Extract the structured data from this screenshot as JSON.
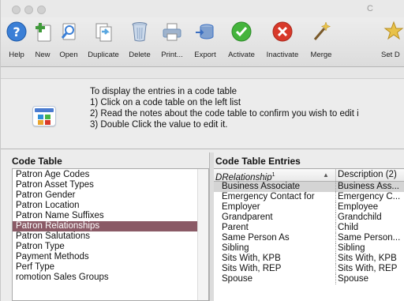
{
  "window": {
    "title": "C"
  },
  "toolbar": {
    "buttons": [
      {
        "label": "Help",
        "icon": "help-icon",
        "color": "#3b7fd6"
      },
      {
        "label": "New",
        "icon": "new-document-icon",
        "color": "#3f9a3a"
      },
      {
        "label": "Open",
        "icon": "open-document-icon",
        "color": "#3b7fd6"
      },
      {
        "label": "Duplicate",
        "icon": "duplicate-icon",
        "color": "#5aa7e0"
      },
      {
        "label": "Delete",
        "icon": "trash-icon",
        "color": "#8fa8c8"
      },
      {
        "label": "Print...",
        "icon": "print-icon",
        "color": "#6c8fb8"
      },
      {
        "label": "Export",
        "icon": "export-icon",
        "color": "#3b6fc1"
      },
      {
        "label": "Activate",
        "icon": "checkmark-icon",
        "color": "#44b43c"
      },
      {
        "label": "Inactivate",
        "icon": "x-icon",
        "color": "#d8392a"
      },
      {
        "label": "Merge",
        "icon": "magic-wand-icon",
        "color": "#d6b34a"
      },
      {
        "label": "Set D",
        "icon": "set-default-icon",
        "color": "#d6b34a"
      }
    ]
  },
  "instructions": {
    "icon": "code-table-icon",
    "lines": [
      "To display the entries in a code table",
      "1) Click on a code table on the left list",
      "2) Read the notes about the code table to confirm you wish to edit i",
      "3) Double Click the value to edit it."
    ]
  },
  "left_pane": {
    "header": "Code Table",
    "items": [
      "Patron Age Codes",
      "Patron Asset Types",
      "Patron Gender",
      "Patron Location",
      "Patron Name Suffixes",
      "Patron Relationships",
      "Patron Salutations",
      "Patron Type",
      "Payment Methods",
      "Perf Type",
      "romotion Sales Groups"
    ],
    "selected_index": 5
  },
  "right_pane": {
    "header": "Code Table Entries",
    "columns": [
      "Relationship",
      "Description (2)"
    ],
    "first_column_prefix": "D",
    "first_column_sort_rank": "1",
    "sort_arrow": "▲",
    "rows": [
      [
        "Business Associate",
        "Business Ass..."
      ],
      [
        "Emergency Contact for",
        "Emergency C..."
      ],
      [
        "Employer",
        "Employee"
      ],
      [
        "Grandparent",
        "Grandchild"
      ],
      [
        "Parent",
        "Child"
      ],
      [
        "Same Person As",
        "Same Person..."
      ],
      [
        "Sibling",
        "Sibling"
      ],
      [
        "Sits With, KPB",
        "Sits With, KPB"
      ],
      [
        "Sits With, REP",
        "Sits With, REP"
      ],
      [
        "Spouse",
        "Spouse"
      ]
    ],
    "selected_row": 0
  },
  "colors": {
    "selection": "#8a5a66",
    "accent": "#4a7bd0",
    "highlight_row": "#d4d4d4"
  }
}
